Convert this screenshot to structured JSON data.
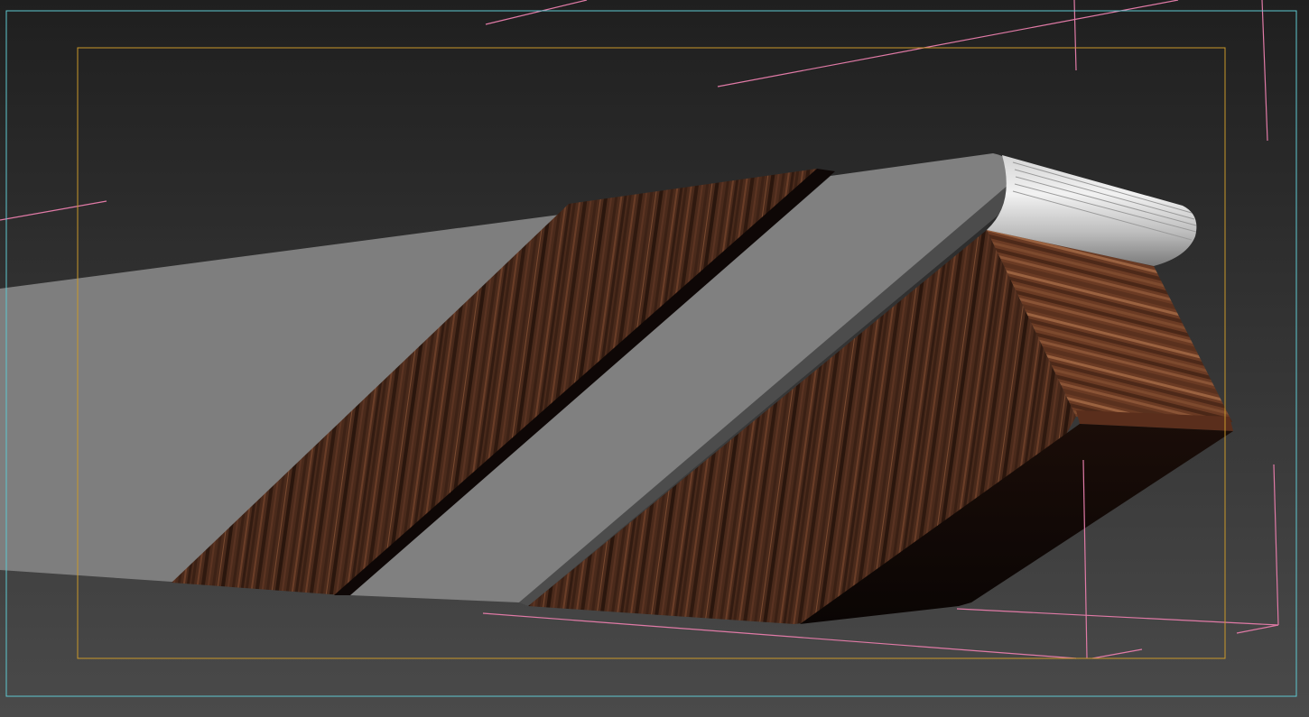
{
  "viewport": {
    "background_top": "#1f1f1f",
    "background_bottom": "#4a4a4a",
    "camera_frame_color": "#5ec8d0",
    "safe_frame_color": "#c9982a",
    "helper_line_color": "#e07aa6"
  },
  "materials": {
    "gray_panel": "#7e7e7e",
    "gray_panel_edge": "#6a6a6a",
    "gray_strip_shadow": "#4f4f4f",
    "wood_dark": "#3a2014",
    "wood_mid": "#5a3322",
    "wood_light": "#7a4a30",
    "wood_shadow": "#0e0706",
    "cylinder_light": "#e8e8e8",
    "cylinder_dark": "#8a8a8a"
  }
}
